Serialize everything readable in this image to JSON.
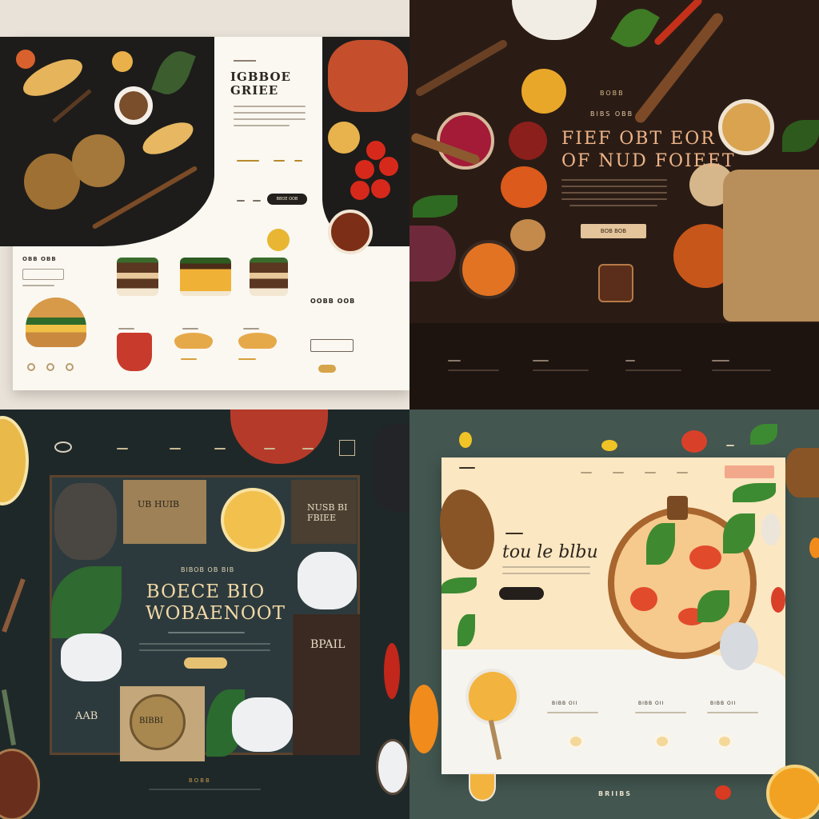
{
  "q1": {
    "title_line1": "IGBBOE",
    "title_line2": "GRIEE",
    "section_label": "OBB OBB",
    "price_label": "OOBB OOB",
    "cta_label": "BBOE OOB"
  },
  "q2": {
    "kicker": "BOBB",
    "subkicker": "BIBS OBB",
    "title_line1": "FIEF OBT EOR",
    "title_line2": "OF NUD FOIEET",
    "button_label": "BOB BOB"
  },
  "q3": {
    "badge1_line1": "UB HUIB",
    "badge2_line1": "NUSB BI",
    "badge2_line2": "FBIEE",
    "kicker": "BIBOB OB BIB",
    "title_line1": "BOECE BIO",
    "title_line2": "WOBAENOOT",
    "side1": "BPAIL",
    "side2": "AAB",
    "stamp": "BIBBI",
    "footer": "BOBB"
  },
  "q4": {
    "title": "tou le blbu",
    "footer": "BRIIBS",
    "feature_labels": [
      "BIBB OII",
      "BIBB OII",
      "BIBB OII"
    ]
  },
  "colors": {
    "q1_dark": "#1d1c1a",
    "q1_cream": "#fbf8f1",
    "q2_bg": "#2a1c15",
    "q2_accent": "#efb488",
    "q3_bg": "#1f2829",
    "q3_gold": "#f1d9a7",
    "q4_bg": "#435650",
    "q4_card": "#fbe7c2"
  }
}
